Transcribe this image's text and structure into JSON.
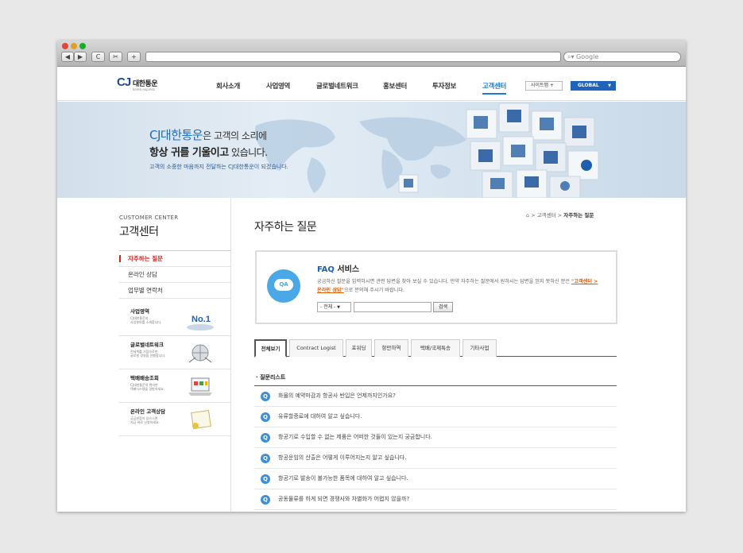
{
  "browser": {
    "search_placeholder": "Google",
    "nav": {
      "back": "◀",
      "forward": "▶",
      "reload": "C",
      "snap": "✂",
      "add": "+"
    }
  },
  "header": {
    "logo_mark": "CJ",
    "logo_name": "대한통운",
    "logo_sub": "korea express",
    "menu": [
      "회사소개",
      "사업영역",
      "글로벌네트워크",
      "홍보센터",
      "투자정보",
      "고객센터"
    ],
    "active_menu": "고객센터",
    "sitemap_label": "사이트맵 +",
    "global_label": "GLOBAL"
  },
  "hero": {
    "line1_brand": "CJ대한통운",
    "line1_rest": "은 고객의 소리에",
    "line2_bold": "항상 귀를 기울이고",
    "line2_rest": " 있습니다.",
    "line3": "고객의 소중한 마음까지 전달하는 CJ대한통운이 되겠습니다.",
    "accent_color": "#1c6dbd"
  },
  "sidebar": {
    "title_en": "CUSTOMER CENTER",
    "title_ko": "고객센터",
    "items": [
      {
        "label": "자주하는 질문",
        "active": true
      },
      {
        "label": "온라인 상담",
        "active": false
      },
      {
        "label": "업무별 연락처",
        "active": false
      }
    ],
    "banners": [
      {
        "title": "사업영역",
        "desc1": "CJ대한통운의",
        "desc2": "사업분야를 소개합니다.",
        "badge": "No.1"
      },
      {
        "title": "글로벌네트워크",
        "desc1": "전세계를 거점으로한",
        "desc2": "글로벌 경영을 진행합니다."
      },
      {
        "title": "택배배송조회",
        "desc1": "CJ대한통운의 편리한",
        "desc2": "택배시스템을 경험하세요."
      },
      {
        "title": "온라인 고객상담",
        "desc1": "궁금한점이 있으시면",
        "desc2": "지금 바로 신청하세요."
      }
    ]
  },
  "main": {
    "title": "자주하는 질문",
    "breadcrumb": [
      "고객센터",
      "자주하는 질문"
    ],
    "faq": {
      "icon_text": "QA",
      "title_en": "FAQ",
      "title_ko": " 서비스",
      "desc_part1": "궁금하신 질문을 입력하시면 관련 답변을 찾아 보실 수 있습니다. 만약 자주하는 질문에서 원하시는 답변을 얻지 못하신 분은 ",
      "desc_link": "\"고객센터 > 온라인 상담\"",
      "desc_part2": "으로 문의해 주시기 바랍니다.",
      "select_value": "- 전체 -",
      "search_button": "검색"
    },
    "tabs": [
      "전체보기",
      "Contract Logist",
      "포워딩",
      "항만하역",
      "택배/국제특송",
      "기타사업"
    ],
    "active_tab": "전체보기",
    "list_title": "질문리스트",
    "questions": [
      "화물의 예약마감과 항공사 반입은 언제까지인가요?",
      "유류할증료에 대하여 알고 싶습니다.",
      "항공기로 수입할 수 없는 제품은 어떠한 것들이 있는지 궁금합니다.",
      "항공운임의 산출은 어떻게 이루어지는지 알고 싶습니다.",
      "항공기로 발송이 불가능한 품목에 대하여 알고 싶습니다.",
      "공동물류를 하게 되면 경쟁사와 차별화가 어렵지 않을까?"
    ],
    "question_icon": "Q",
    "question_icon_color": "#3d8fd9"
  }
}
